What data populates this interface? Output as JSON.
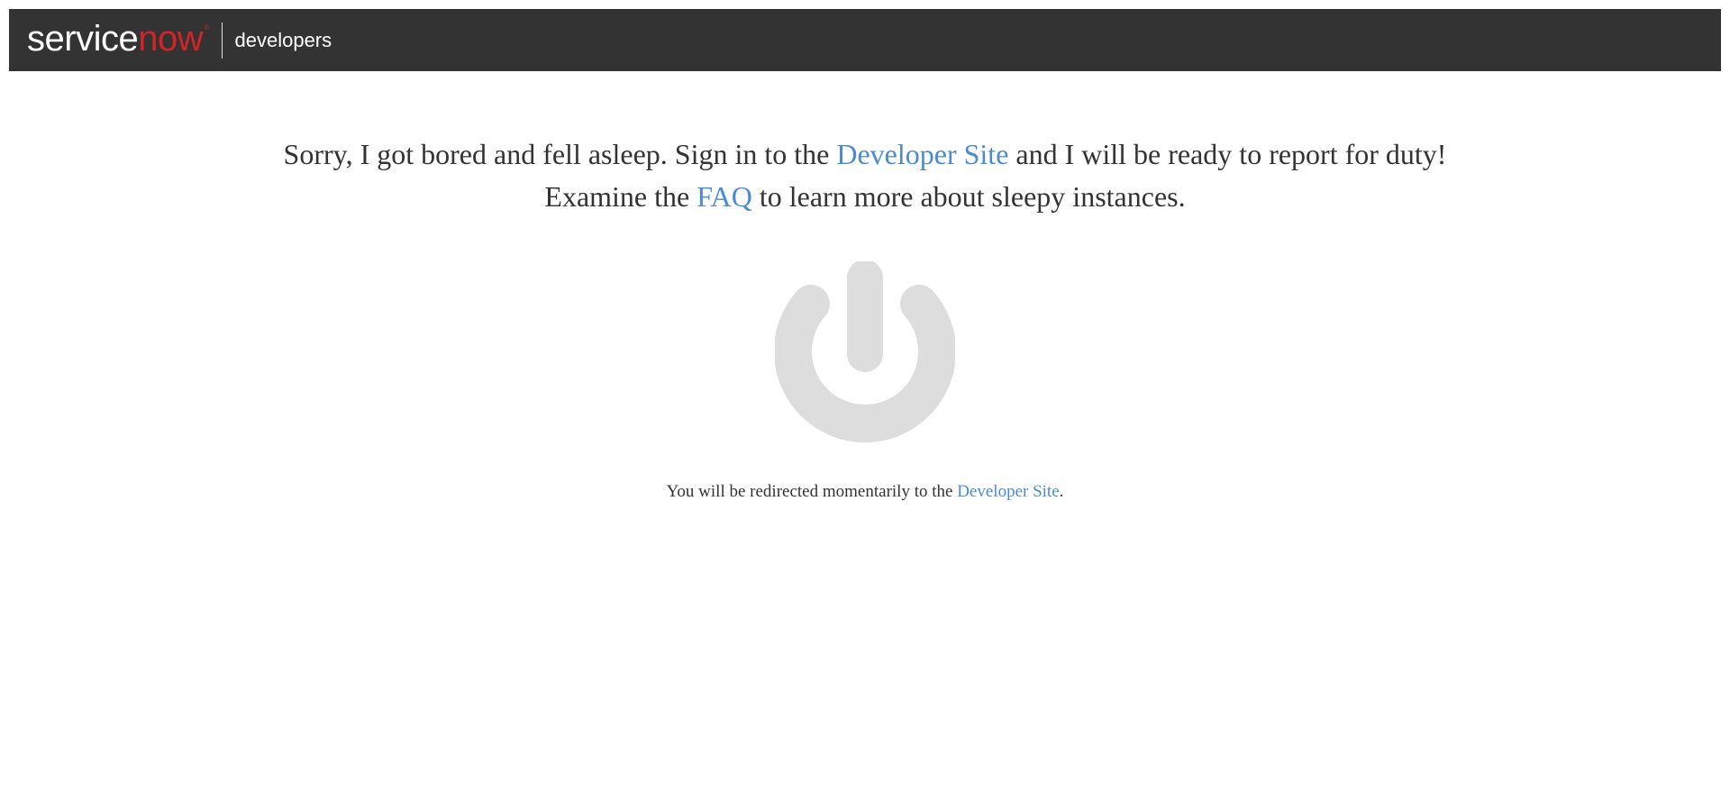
{
  "header": {
    "logo_service": "service",
    "logo_now": "now",
    "logo_reg": "®",
    "subtitle": "developers",
    "brand_color": "#d1232a",
    "bar_color": "#333333"
  },
  "message": {
    "line1_before": "Sorry, I got bored and fell asleep. Sign in to the ",
    "line1_link": "Developer Site",
    "line1_after": " and I will be ready to report for duty!",
    "line2_before": "Examine the ",
    "line2_link": "FAQ",
    "line2_after": " to learn more about sleepy instances."
  },
  "power_icon": {
    "name": "power-icon",
    "color": "#dddddd"
  },
  "redirect": {
    "before": "You will be redirected momentarily to the ",
    "link": "Developer Site",
    "after": "."
  },
  "colors": {
    "link": "#4a8bd4",
    "text": "#333333"
  }
}
